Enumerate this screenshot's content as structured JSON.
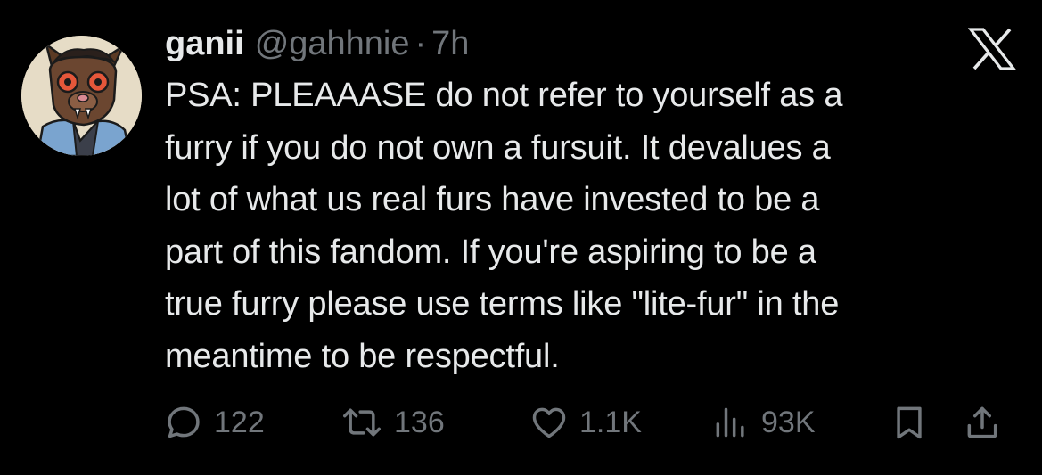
{
  "tweet": {
    "display_name": "ganii",
    "handle": "@gahhnie",
    "separator": "·",
    "time": "7h",
    "avatar_icon": "furry-avatar",
    "platform_logo": "x-logo",
    "body_lines": [
      "PSA: PLEAAASE do not refer to yourself as a",
      "furry if you do not own a fursuit. It devalues a",
      "lot of what us real furs have invested to be a",
      "part of this fandom. If you're aspiring to be a",
      "true furry please use terms like \"lite-fur\" in the",
      "meantime to be respectful."
    ],
    "actions": {
      "replies": "122",
      "retweets": "136",
      "likes": "1.1K",
      "views": "93K"
    }
  },
  "colors": {
    "background": "#000000",
    "primary_text": "#e7e9ea",
    "secondary_text": "#71767b"
  }
}
